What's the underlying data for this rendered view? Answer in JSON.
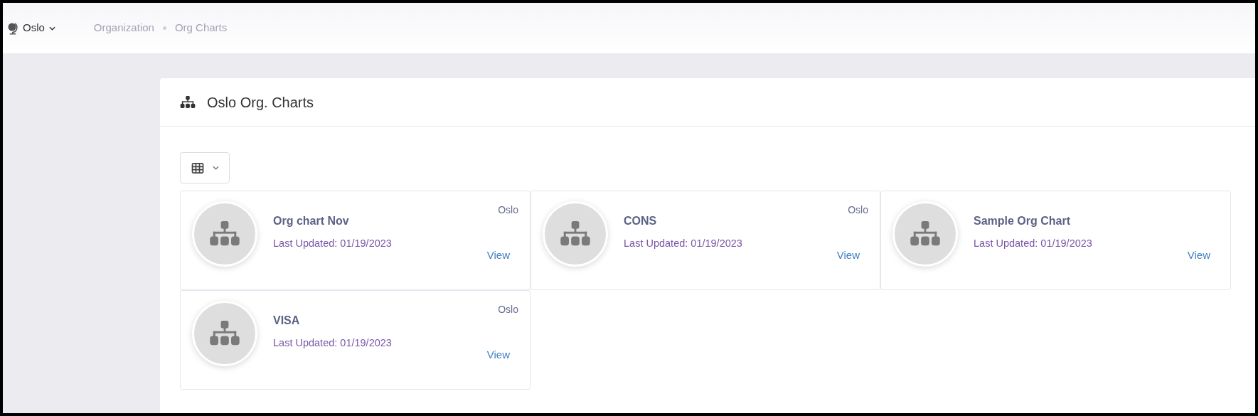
{
  "top_bar": {
    "location": "Oslo",
    "breadcrumbs": [
      "Organization",
      "Org Charts"
    ]
  },
  "panel": {
    "title": "Oslo Org. Charts",
    "cards": [
      {
        "name": "Org chart Nov",
        "location": "Oslo",
        "updated": "Last Updated: 01/19/2023",
        "action": "View"
      },
      {
        "name": "CONS",
        "location": "Oslo",
        "updated": "Last Updated: 01/19/2023",
        "action": "View"
      },
      {
        "name": "Sample Org Chart",
        "updated": "Last Updated: 01/19/2023",
        "action": "View"
      },
      {
        "name": "VISA",
        "location": "Oslo",
        "updated": "Last Updated: 01/19/2023",
        "action": "View"
      }
    ]
  }
}
